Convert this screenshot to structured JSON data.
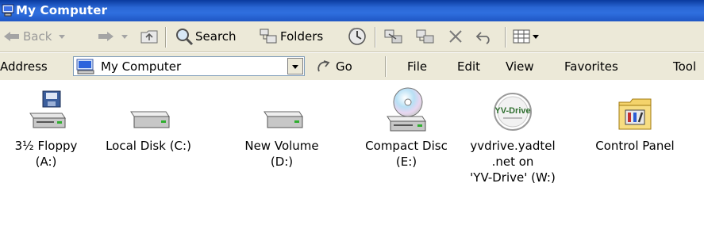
{
  "window": {
    "title": "My Computer"
  },
  "toolbar": {
    "back": "Back",
    "search": "Search",
    "folders": "Folders"
  },
  "address": {
    "label": "Address",
    "value": "My Computer",
    "go": "Go"
  },
  "menu": [
    "File",
    "Edit",
    "View",
    "Favorites",
    "Tool"
  ],
  "drives": [
    {
      "label": "3½ Floppy\n(A:)",
      "icon": "floppy-drive-icon"
    },
    {
      "label": "Local Disk (C:)",
      "icon": "hard-disk-icon"
    },
    {
      "label": "New Volume\n(D:)",
      "icon": "hard-disk-icon"
    },
    {
      "label": "Compact Disc\n(E:)",
      "icon": "cd-drive-icon"
    },
    {
      "label": "yvdrive.yadtel\n.net on\n'YV-Drive' (W:)",
      "icon": "network-drive-icon",
      "icon_text": "YV-Drive"
    },
    {
      "label": "Control Panel",
      "icon": "control-panel-icon"
    }
  ],
  "colors": {
    "titlebar": "#2a66d4",
    "toolbar": "#ece9d8",
    "text": "#000000"
  }
}
